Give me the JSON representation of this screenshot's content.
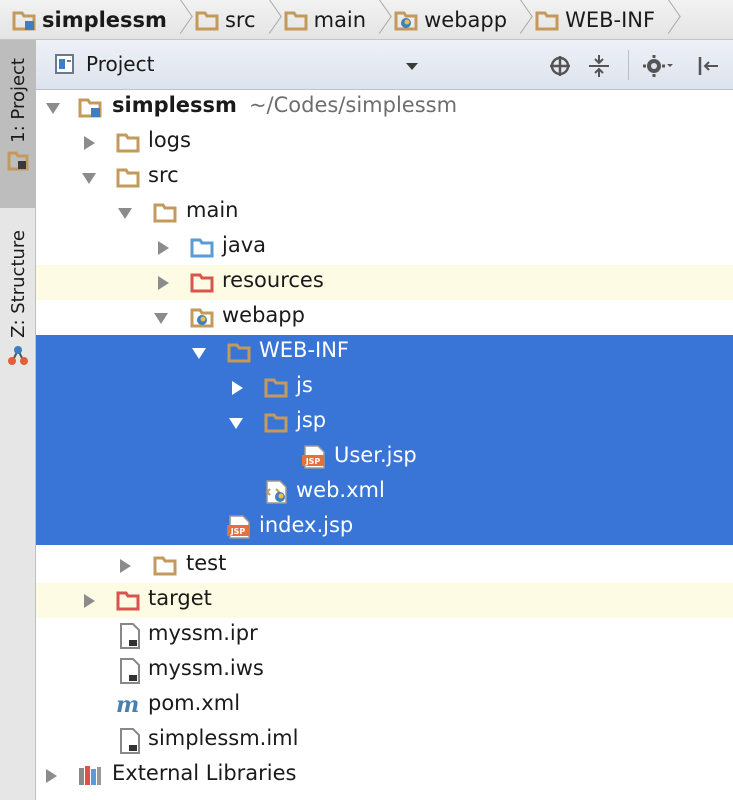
{
  "breadcrumb": [
    {
      "label": "simplessm",
      "icon": "module-folder-icon"
    },
    {
      "label": "src",
      "icon": "folder-icon"
    },
    {
      "label": "main",
      "icon": "folder-icon"
    },
    {
      "label": "webapp",
      "icon": "web-folder-icon"
    },
    {
      "label": "WEB-INF",
      "icon": "folder-icon"
    }
  ],
  "toolstrip": {
    "project_tab": "1: Project",
    "structure_tab": "Z: Structure"
  },
  "header": {
    "title": "Project"
  },
  "tree": [
    {
      "label": "simplessm",
      "suffix": "~/Codes/simplessm",
      "bold": true,
      "icon": "module-folder-icon",
      "expanded": true
    },
    {
      "label": "logs",
      "icon": "folder-icon",
      "expanded": false
    },
    {
      "label": "src",
      "icon": "folder-icon",
      "expanded": true
    },
    {
      "label": "main",
      "icon": "folder-icon",
      "expanded": true
    },
    {
      "label": "java",
      "icon": "source-folder-icon",
      "expanded": false
    },
    {
      "label": "resources",
      "icon": "resources-folder-icon",
      "expanded": false
    },
    {
      "label": "webapp",
      "icon": "web-folder-icon",
      "expanded": true
    },
    {
      "label": "WEB-INF",
      "icon": "folder-icon",
      "expanded": true
    },
    {
      "label": "js",
      "icon": "folder-icon",
      "expanded": false
    },
    {
      "label": "jsp",
      "icon": "folder-icon",
      "expanded": true
    },
    {
      "label": "User.jsp",
      "icon": "jsp-file-icon"
    },
    {
      "label": "web.xml",
      "icon": "web-xml-file-icon"
    },
    {
      "label": "index.jsp",
      "icon": "jsp-file-icon"
    },
    {
      "label": "test",
      "icon": "folder-icon",
      "expanded": false
    },
    {
      "label": "target",
      "icon": "excluded-folder-icon",
      "expanded": false
    },
    {
      "label": "myssm.ipr",
      "icon": "file-icon"
    },
    {
      "label": "myssm.iws",
      "icon": "file-icon"
    },
    {
      "label": "pom.xml",
      "icon": "maven-icon"
    },
    {
      "label": "simplessm.iml",
      "icon": "file-icon"
    },
    {
      "label": "External Libraries",
      "icon": "libraries-icon",
      "expanded": false
    }
  ],
  "colors": {
    "selection": "#3875d7",
    "highlight_row": "#fdfbe3",
    "folder": "#c39a5c",
    "source_folder": "#5b9bd5",
    "resources_folder": "#d9534f"
  }
}
